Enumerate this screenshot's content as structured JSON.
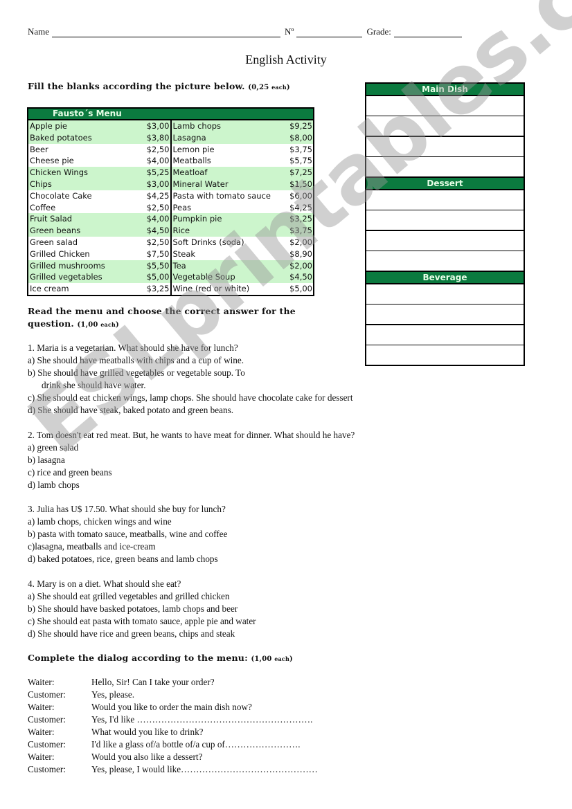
{
  "header": {
    "name_label": "Name",
    "number_label": "Nº",
    "grade_label": "Grade:"
  },
  "title": "English Activity",
  "section1": {
    "heading": "Fill the blanks according the picture below.",
    "points_open": "(0,25 ",
    "points_each": "each",
    "points_close": ")"
  },
  "menu": {
    "title": "Fausto´s Menu",
    "left": [
      {
        "item": "Apple pie",
        "price": "$3,00",
        "green": true
      },
      {
        "item": "Baked potatoes",
        "price": "$3,80",
        "green": true
      },
      {
        "item": "Beer",
        "price": "$2,50",
        "green": false
      },
      {
        "item": "Cheese pie",
        "price": "$4,00",
        "green": false
      },
      {
        "item": "Chicken Wings",
        "price": "$5,25",
        "green": true
      },
      {
        "item": "Chips",
        "price": "$3,00",
        "green": true
      },
      {
        "item": "Chocolate Cake",
        "price": "$4,25",
        "green": false
      },
      {
        "item": "Coffee",
        "price": "$2,50",
        "green": false
      },
      {
        "item": "Fruit Salad",
        "price": "$4,00",
        "green": true
      },
      {
        "item": "Green beans",
        "price": "$4,50",
        "green": true
      },
      {
        "item": "Green salad",
        "price": "$2,50",
        "green": false
      },
      {
        "item": "Grilled Chicken",
        "price": "$7,50",
        "green": false
      },
      {
        "item": "Grilled mushrooms",
        "price": "$5,50",
        "green": true
      },
      {
        "item": "Grilled vegetables",
        "price": "$5,00",
        "green": true
      },
      {
        "item": "Ice cream",
        "price": "$3,25",
        "green": false
      }
    ],
    "right": [
      {
        "item": "Lamb chops",
        "price": "$9,25",
        "green": true
      },
      {
        "item": "Lasagna",
        "price": "$8,00",
        "green": true
      },
      {
        "item": "Lemon pie",
        "price": "$3,75",
        "green": false
      },
      {
        "item": "Meatballs",
        "price": "$5,75",
        "green": false
      },
      {
        "item": "Meatloaf",
        "price": "$7,25",
        "green": true
      },
      {
        "item": "Mineral Water",
        "price": "$1,50",
        "green": true
      },
      {
        "item": "Pasta with tomato sauce",
        "price": "$6,00",
        "green": false
      },
      {
        "item": "Peas",
        "price": "$4,25",
        "green": false
      },
      {
        "item": "Pumpkin pie",
        "price": "$3,25",
        "green": true
      },
      {
        "item": "Rice",
        "price": "$3,75",
        "green": true
      },
      {
        "item": "Soft Drinks (soda)",
        "price": "$2,00",
        "green": false
      },
      {
        "item": "Steak",
        "price": "$8,90",
        "green": false
      },
      {
        "item": "Tea",
        "price": "$2,00",
        "green": true
      },
      {
        "item": "Vegetable Soup",
        "price": "$4,50",
        "green": true
      },
      {
        "item": "Wine (red or white)",
        "price": "$5,00",
        "green": false
      }
    ]
  },
  "answer_grid": [
    {
      "heading": "Main Dish",
      "cells": 4
    },
    {
      "heading": "Dessert",
      "cells": 4
    },
    {
      "heading": "Beverage",
      "cells": 4
    }
  ],
  "section2": {
    "heading_line1": "Read the menu and choose the correct answer for the",
    "heading_line2": "question.",
    "points_open": "(1,00 ",
    "points_each": "each",
    "points_close": ")"
  },
  "questions": [
    {
      "question": "1. Maria is a vegetarian. What should she have for lunch?",
      "options": [
        "a) She should have meatballs with chips and a cup of wine.",
        "b) She should have grilled vegetables or vegetable soup. To",
        "drink she should have water.",
        "c) She should eat chicken wings, lamp chops. She should have chocolate cake for dessert",
        "d) She should have steak, baked potato and green beans."
      ]
    },
    {
      "question": "2. Tom doesn't eat red meat. But, he wants to have meat for dinner. What should  he have?",
      "options": [
        "a) green salad",
        "b) lasagna",
        "c) rice and green beans",
        "d) lamb chops"
      ]
    },
    {
      "question": "3. Julia has U$ 17.50. What should she buy for lunch?",
      "options": [
        "a) lamb chops, chicken wings and wine",
        "b) pasta with tomato sauce, meatballs, wine and coffee",
        "c)lasagna, meatballs and ice-cream",
        "d) baked potatoes, rice, green beans and lamb chops"
      ]
    },
    {
      "question": "4. Mary is on a diet. What should she eat?",
      "options": [
        "a) She should eat grilled vegetables and grilled chicken",
        "b) She should have basked potatoes, lamb chops and beer",
        "c) She should eat pasta with tomato sauce, apple pie and water",
        "d) She should have rice and green beans, chips and steak"
      ]
    }
  ],
  "section3": {
    "heading": "Complete the dialog according to the menu:",
    "points_open": "(1,00 ",
    "points_each": "each",
    "points_close": ")"
  },
  "dialog": [
    {
      "speaker": "Waiter:",
      "line": "Hello, Sir! Can I take your order?"
    },
    {
      "speaker": "Customer:",
      "line": "Yes, please."
    },
    {
      "speaker": "Waiter:",
      "line": "Would you like to order the main dish now?"
    },
    {
      "speaker": "Customer:",
      "line": "Yes, I'd like …………………………………………………."
    },
    {
      "speaker": "Waiter:",
      "line": "What would you like to drink?"
    },
    {
      "speaker": "Customer:",
      "line": "I'd like a glass of/a bottle of/a cup of……………………."
    },
    {
      "speaker": "Waiter:",
      "line": "Would you also like a dessert?"
    },
    {
      "speaker": "Customer:",
      "line": "Yes, please, I would like………………………………………"
    }
  ],
  "watermark": "ESLprintables.com",
  "colors": {
    "menu_header": "#0b7a3f",
    "menu_row_highlight": "#ccf5cc"
  }
}
